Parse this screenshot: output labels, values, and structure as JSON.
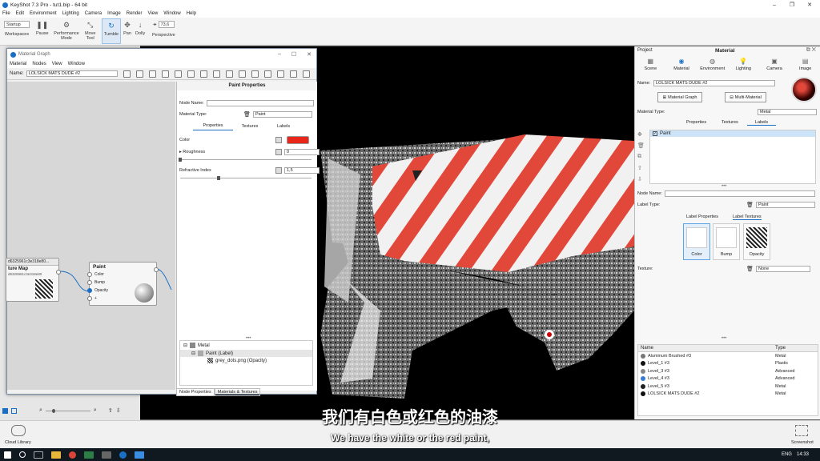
{
  "app": {
    "title": "KeyShot 7.3 Pro - tut1.bip - 64 bit",
    "window_controls": [
      "–",
      "❐",
      "✕"
    ]
  },
  "menu": [
    "File",
    "Edit",
    "Environment",
    "Lighting",
    "Camera",
    "Image",
    "Render",
    "View",
    "Window",
    "Help"
  ],
  "toolbar": {
    "workspace_value": "Startup",
    "workspaces_label": "Workspaces",
    "pause": "Pause",
    "performance": "Performance\nMode",
    "move": "Move\nTool",
    "tumble": "Tumble",
    "pan": "Pan",
    "dolly": "Dolly",
    "fov": "73,6",
    "perspective": "Perspective"
  },
  "material_graph": {
    "title": "Material Graph",
    "menu": [
      "Material",
      "Nodes",
      "View",
      "Window"
    ],
    "name_label": "Name:",
    "name_value": "LOLSICK MATS DUDE #2",
    "texture_node": {
      "id": "d6325961c3e318e80...",
      "title": "ture Map",
      "sub": "d6325961c3e318e80"
    },
    "paint_node": {
      "title": "Paint",
      "ports": [
        "Color",
        "Bump",
        "Opacity",
        "+"
      ]
    },
    "bottom_tabs": [
      "Node Properties",
      "Materials & Textures"
    ]
  },
  "paint_props": {
    "title": "Paint Properties",
    "node_name_label": "Node Name:",
    "material_type_label": "Material Type:",
    "material_type_value": "Paint",
    "tabs": [
      "Properties",
      "Textures",
      "Labels"
    ],
    "color_label": "Color",
    "color_value": "#e8261a",
    "roughness_label": "Roughness",
    "roughness_value": "0",
    "roughness": 0,
    "refractive_label": "Refractive Index",
    "refractive_value": "1,5",
    "refractive": 0.3,
    "tree": [
      "Metal",
      "Paint (Label)",
      "grey_dots.png (Opacity)"
    ]
  },
  "right_panel": {
    "project": "Project",
    "material": "Material",
    "tabs": [
      "Scene",
      "Material",
      "Environment",
      "Lighting",
      "Camera",
      "Image"
    ],
    "name_label": "Name:",
    "name_value": "LOLSICK MATS DUDE #2",
    "material_graph_btn": "Material Graph",
    "multi_material_btn": "Multi-Material",
    "material_type_label": "Material Type:",
    "material_type_value": "Metal",
    "subtabs": [
      "Properties",
      "Textures",
      "Labels"
    ],
    "label_item": "Paint",
    "node_name_label": "Node Name:",
    "label_type_label": "Label Type:",
    "label_type_value": "Paint",
    "label_tabs": [
      "Label Properties",
      "Label Textures"
    ],
    "tex_slots": [
      "Color",
      "Bump",
      "Opacity"
    ],
    "texture_label": "Texture:",
    "texture_value": "None",
    "table": {
      "headers": [
        "Name",
        "Type"
      ],
      "rows": [
        {
          "name": "Aluminum Brushed #3",
          "type": "Metal",
          "color": "#777"
        },
        {
          "name": "Level_1 #3",
          "type": "Plastic",
          "color": "#111"
        },
        {
          "name": "Level_3 #3",
          "type": "Advanced",
          "color": "#888"
        },
        {
          "name": "Level_4 #3",
          "type": "Advanced",
          "color": "#3a7bd5"
        },
        {
          "name": "Level_5 #3",
          "type": "Metal",
          "color": "#222"
        },
        {
          "name": "LOLSICK MATS DUDE #2",
          "type": "Metal",
          "color": "#111"
        }
      ]
    }
  },
  "bottom": {
    "cloud": "Cloud Library",
    "screenshot": "Screenshot"
  },
  "subtitle": {
    "zh": "我们有白色或红色的油漆",
    "en": "We have the white or the red paint,"
  },
  "taskbar": {
    "lang": "ENG",
    "time": "14:33"
  }
}
